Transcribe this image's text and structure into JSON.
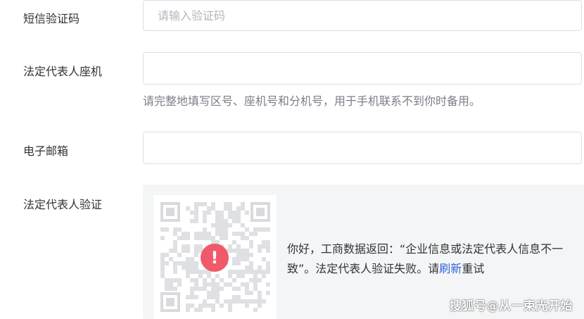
{
  "form": {
    "sms_code": {
      "label": "短信验证码",
      "placeholder": "请输入验证码",
      "value": ""
    },
    "landline": {
      "label": "法定代表人座机",
      "placeholder": "",
      "value": "",
      "hint": "请完整地填写区号、座机号和分机号，用于手机联系不到你时备用。"
    },
    "email": {
      "label": "电子邮箱",
      "placeholder": "",
      "value": ""
    },
    "verify": {
      "label": "法定代表人验证",
      "icon": "exclamation-circle-icon",
      "icon_glyph": "!",
      "message_prefix": "你好，工商数据返回：“企业信息或法定代表人信息不一致”。法定代表人验证失败。请",
      "refresh_link": "刷新",
      "message_suffix": "重试"
    }
  },
  "watermark": "搜狐号@从一束光开始",
  "colors": {
    "accent": "#2d63d8",
    "alert": "#f0596a",
    "border": "#dcdfe6",
    "panel_bg": "#f4f5f7"
  }
}
